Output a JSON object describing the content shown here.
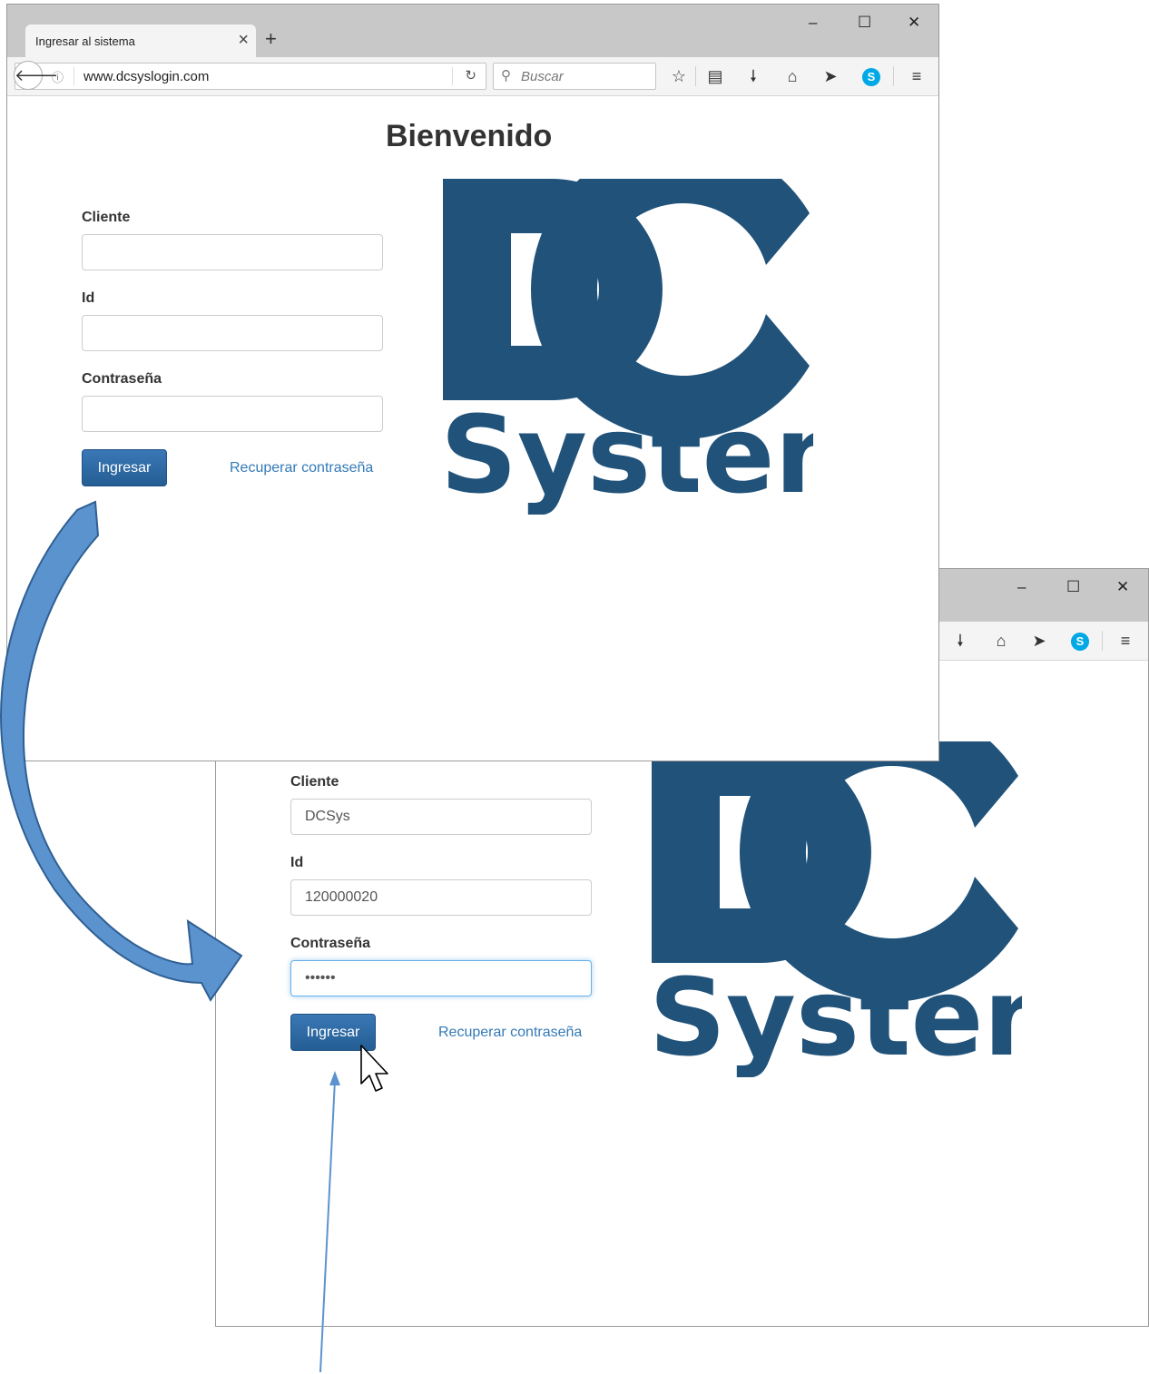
{
  "browser": {
    "tab_title": "Ingresar al sistema",
    "tab_close": "×",
    "new_tab": "+",
    "url": "www.dcsyslogin.com",
    "search_placeholder": "Buscar",
    "window_controls": {
      "minimize": "–",
      "maximize": "☐",
      "close": "✕"
    }
  },
  "page": {
    "heading": "Bienvenido",
    "labels": {
      "client": "Cliente",
      "id": "Id",
      "password": "Contraseña"
    },
    "submit_label": "Ingresar",
    "recover_link": "Recuperar contraseña",
    "logo": {
      "top": "DC",
      "bottom": "System",
      "color": "#20527a"
    }
  },
  "filled_form": {
    "client_value": "DCSys",
    "id_value": "120000020",
    "password_value": "••••••"
  },
  "icons": [
    "back-arrow-icon",
    "info-icon",
    "reload-icon",
    "search-icon",
    "star-icon",
    "reading-list-icon",
    "download-icon",
    "home-icon",
    "send-icon",
    "skype-icon",
    "menu-icon",
    "cursor-icon",
    "curved-arrow-icon",
    "pointer-arrow-icon"
  ],
  "colors": {
    "arrow": "#4f86c6",
    "button": "#2d6aa6",
    "link": "#337ab7"
  }
}
